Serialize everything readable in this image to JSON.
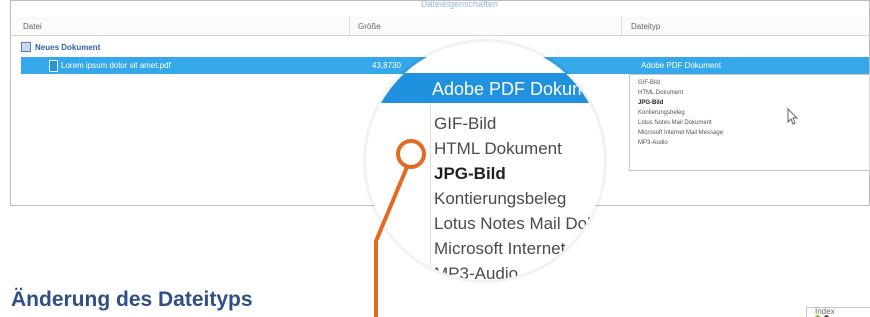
{
  "top": {
    "faded_title": "Dateieigenschaften"
  },
  "headers": {
    "name": "Datei",
    "size": "Größe",
    "type": "Dateityp"
  },
  "group": {
    "label": "Neues Dokument"
  },
  "row": {
    "file_name": "Lorem ipsum dolor sit amet.pdf",
    "size": "43,8730",
    "type": "Adobe PDF Dokument"
  },
  "dropdown": {
    "items": [
      "GIF-Bild",
      "HTML Dokument",
      "JPG-Bild",
      "Kontierungsbeleg",
      "Lotus Notes Mail Dokument",
      "Microsoft Internet Mail Message",
      "MP3-Audio"
    ],
    "selected": "JPG-Bild"
  },
  "magnifier": {
    "title": "Adobe PDF Dokumen",
    "items": [
      "GIF-Bild",
      "HTML Dokument",
      "JPG-Bild",
      "Kontierungsbeleg",
      "Lotus Notes Mail Dokum",
      "Microsoft Internet Ma",
      "MP3-Audio"
    ]
  },
  "caption": "Änderung des Dateityps",
  "side_panel": {
    "title": "Index"
  },
  "colors": {
    "selection_blue": "#34a8ea",
    "magnifier_blue": "#1f91de",
    "callout_orange": "#e56a21",
    "caption_blue": "#2f4f86"
  }
}
